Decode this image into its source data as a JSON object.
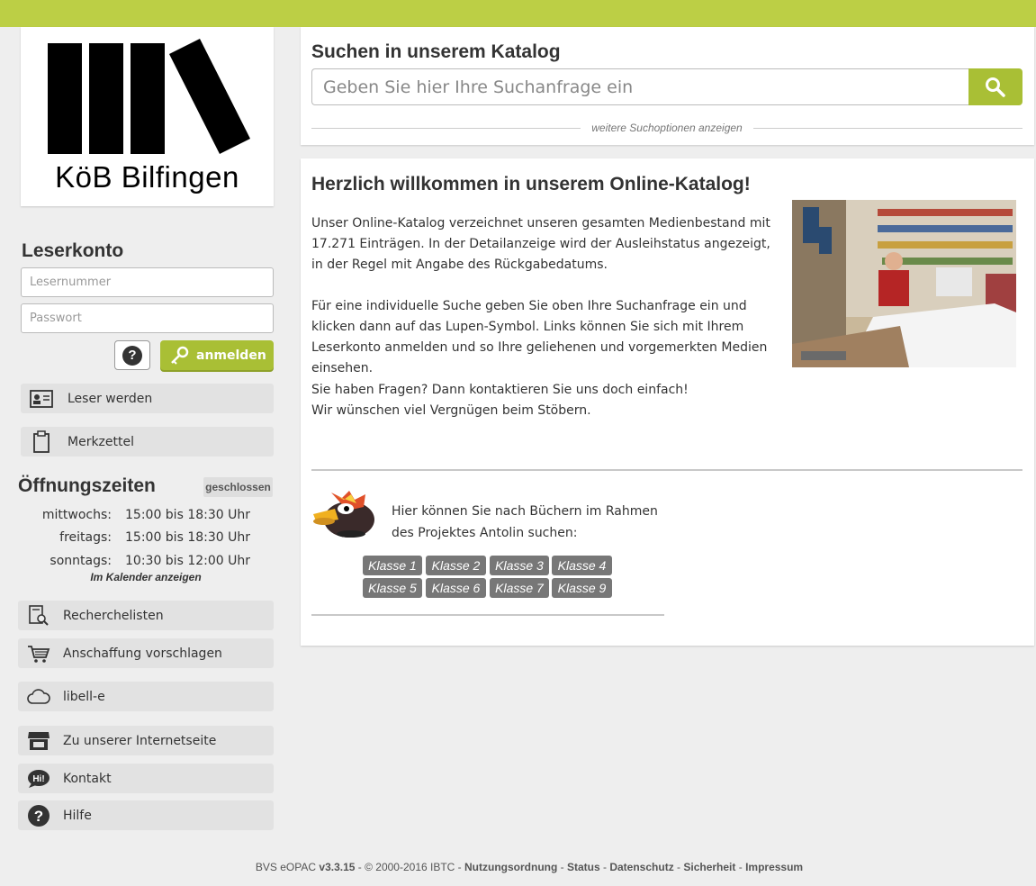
{
  "logo": {
    "text": "KöB Bilfingen"
  },
  "sidebar": {
    "account_heading": "Leserkonto",
    "reader_number_placeholder": "Lesernummer",
    "password_placeholder": "Passwort",
    "help_label": "?",
    "login_label": "anmelden",
    "become_reader": "Leser werden",
    "notepad": "Merkzettel",
    "hours_heading": "Öffnungszeiten",
    "hours_status": "geschlossen",
    "hours": [
      {
        "day": "mittwochs:",
        "time": "15:00 bis 18:30 Uhr"
      },
      {
        "day": "freitags:",
        "time": "15:00 bis 18:30 Uhr"
      },
      {
        "day": "sonntags:",
        "time": "10:30 bis 12:00 Uhr"
      }
    ],
    "calendar_link": "Im Kalender anzeigen",
    "research_lists": "Recherchelisten",
    "suggest_purchase": "Anschaffung vorschlagen",
    "libell_e": "libell-e",
    "website": "Zu unserer Internetseite",
    "contact": "Kontakt",
    "contact_icon_text": "Hi!",
    "help": "Hilfe"
  },
  "search": {
    "title": "Suchen in unserem Katalog",
    "placeholder": "Geben Sie hier Ihre Suchanfrage ein",
    "more_options": "weitere Suchoptionen anzeigen"
  },
  "welcome": {
    "title": "Herzlich willkommen in unserem Online-Katalog!",
    "p1": "Unser Online-Katalog verzeichnet unseren gesamten Medienbestand mit 17.271 Einträgen. In der Detailanzeige wird der Ausleihstatus angezeigt, in der Regel mit Angabe des Rückgabedatums.",
    "p2": "Für eine individuelle Suche geben Sie oben Ihre Suchanfrage ein und klicken dann auf das Lupen-Symbol. Links können Sie sich mit Ihrem Leserkonto anmelden und so Ihre geliehenen und vorgemerkten Medien einsehen.",
    "p3_line1": "Sie haben Fragen? Dann kontaktieren Sie uns doch einfach!",
    "p3_line2": "Wir wünschen viel Vergnügen beim Stöbern."
  },
  "antolin": {
    "text_line1": "Hier können Sie nach Büchern im Rahmen",
    "text_line2": "des Projektes Antolin suchen:",
    "classes": [
      "Klasse 1",
      "Klasse 2",
      "Klasse 3",
      "Klasse 4",
      "Klasse 5",
      "Klasse 6",
      "Klasse 7",
      "Klasse 9"
    ]
  },
  "footer": {
    "prefix": "BVS eOPAC ",
    "version": "v3.3.15",
    "copyright": " - © 2000-2016 IBTC - ",
    "links": [
      "Nutzungsordnung",
      "Status",
      "Datenschutz",
      "Sicherheit",
      "Impressum"
    ]
  },
  "colors": {
    "accent": "#a9bf35",
    "topbar": "#bccf45",
    "klasse": "#777777"
  }
}
